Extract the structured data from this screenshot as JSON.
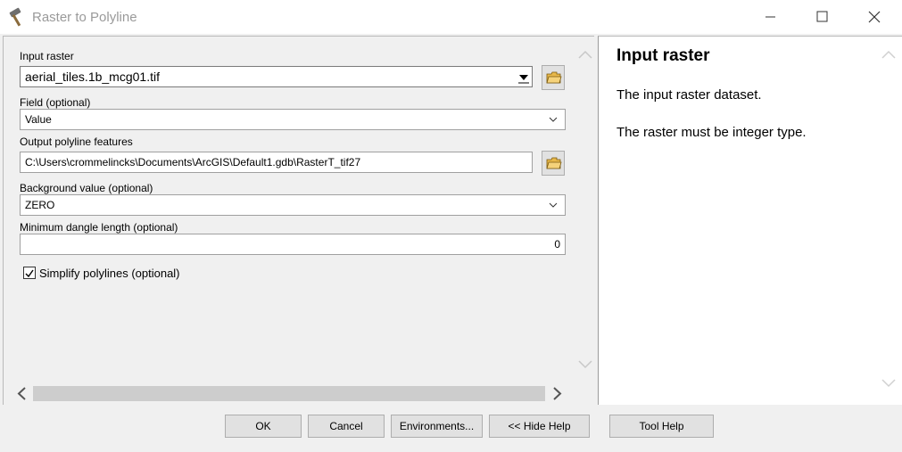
{
  "window": {
    "title": "Raster to Polyline"
  },
  "params": {
    "input_raster": {
      "label": "Input raster",
      "value": "aerial_tiles.1b_mcg01.tif"
    },
    "field": {
      "label": "Field (optional)",
      "value": "Value"
    },
    "output": {
      "label": "Output polyline features",
      "value": "C:\\Users\\crommelincks\\Documents\\ArcGIS\\Default1.gdb\\RasterT_tif27"
    },
    "background": {
      "label": "Background value (optional)",
      "value": "ZERO"
    },
    "min_dangle": {
      "label": "Minimum dangle length (optional)",
      "value": "0"
    },
    "simplify": {
      "label": "Simplify polylines (optional)",
      "checked": true
    }
  },
  "help": {
    "title": "Input raster",
    "paragraphs": [
      "The input raster dataset.",
      "The raster must be integer type."
    ]
  },
  "buttons": {
    "ok": "OK",
    "cancel": "Cancel",
    "environments": "Environments...",
    "hide_help": "<< Hide Help",
    "tool_help": "Tool Help"
  },
  "icons": {
    "app": "hammer-icon",
    "browse": "open-folder-icon",
    "dropdown": "chevron-down-icon"
  },
  "colors": {
    "folder": "#e8b84a",
    "scroll_track": "#cdcdcd"
  }
}
